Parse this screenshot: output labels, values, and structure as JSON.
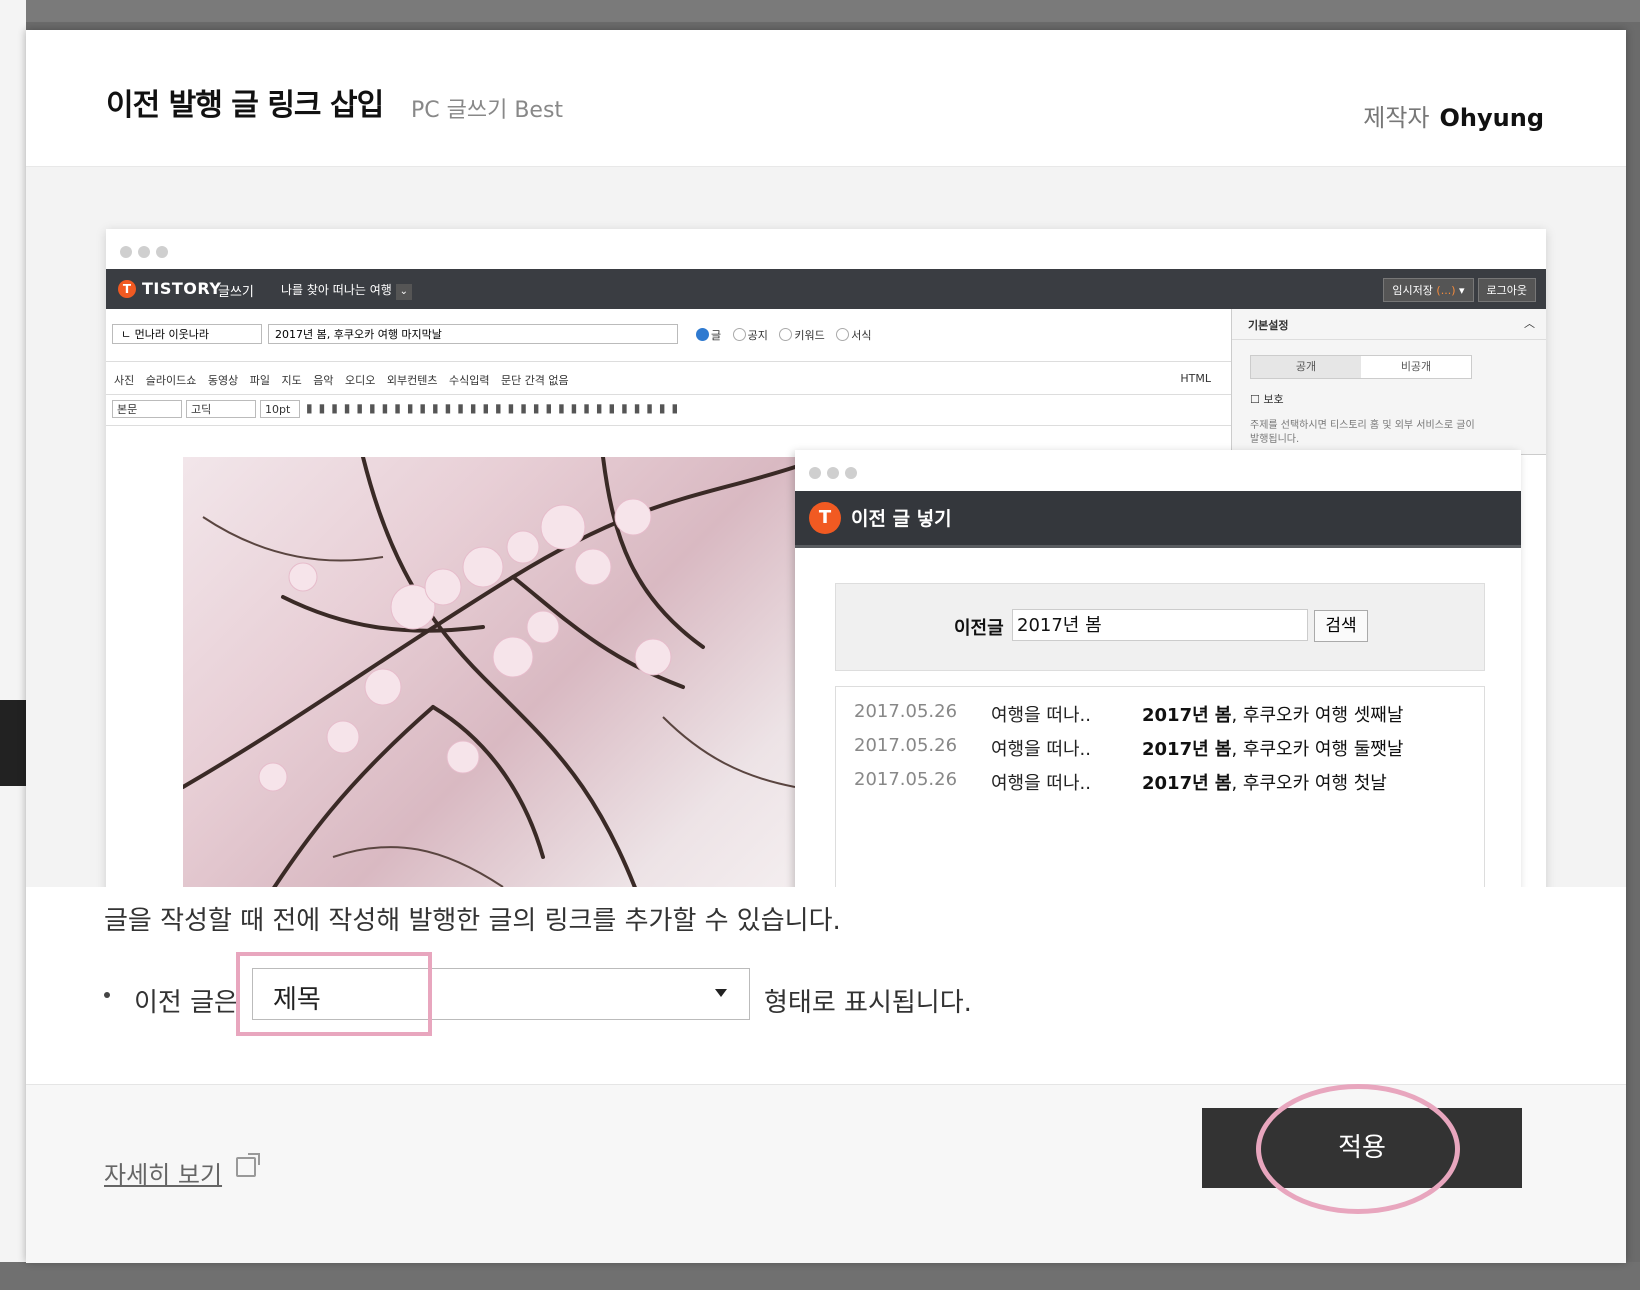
{
  "modal": {
    "title": "이전 발행 글 링크 삽입",
    "subtitle": "PC 글쓰기 Best",
    "author_label": "제작자",
    "author_name": "Ohyung"
  },
  "editor": {
    "logo": "TISTORY",
    "logo_sub": "글쓰기",
    "blog_name": "나를 찾아 떠나는 여행",
    "temp_save": "임시저장",
    "temp_save_count": "(...)",
    "logout": "로그아웃",
    "category": "ㄴ 먼나라 이웃나라",
    "post_title": "2017년 봄, 후쿠오카 여행 마지막날",
    "radios": [
      "글",
      "공지",
      "키워드",
      "서식"
    ],
    "insert_tools": [
      "사진",
      "슬라이드쇼",
      "동영상",
      "파일",
      "지도",
      "음악",
      "오디오",
      "외부컨텐츠",
      "수식입력",
      "문단 간격 없음"
    ],
    "html_label": "HTML",
    "format": {
      "style": "본문",
      "font": "고딕",
      "size": "10pt"
    },
    "side": {
      "header": "기본설정",
      "public": "공개",
      "private": "비공개",
      "protect": "보호",
      "note": "주제를 선택하시면 티스토리 홈 및 외부 서비스로 글이 발행됩니다."
    }
  },
  "popup": {
    "title": "이전 글 넣기",
    "search_label": "이전글",
    "search_value": "2017년 봄",
    "search_button": "검색",
    "results": [
      {
        "date": "2017.05.26",
        "category": "여행을 떠나..",
        "title_bold": "2017년 봄",
        "title_rest": ", 후쿠오카 여행 셋째날"
      },
      {
        "date": "2017.05.26",
        "category": "여행을 떠나..",
        "title_bold": "2017년 봄",
        "title_rest": ", 후쿠오카 여행 둘쨋날"
      },
      {
        "date": "2017.05.26",
        "category": "여행을 떠나..",
        "title_bold": "2017년 봄",
        "title_rest": ", 후쿠오카 여행 첫날"
      }
    ]
  },
  "settings": {
    "description": "글을 작성할 때 전에 작성해 발행한 글의 링크를 추가할 수 있습니다.",
    "option_prefix": "이전 글은",
    "option_value": "제목",
    "option_suffix": "형태로 표시됩니다."
  },
  "footer": {
    "more_link": "자세히 보기",
    "apply": "적용"
  },
  "colors": {
    "accent": "#f15a22",
    "highlight": "#e8a6be",
    "apply_bg": "#333333"
  }
}
